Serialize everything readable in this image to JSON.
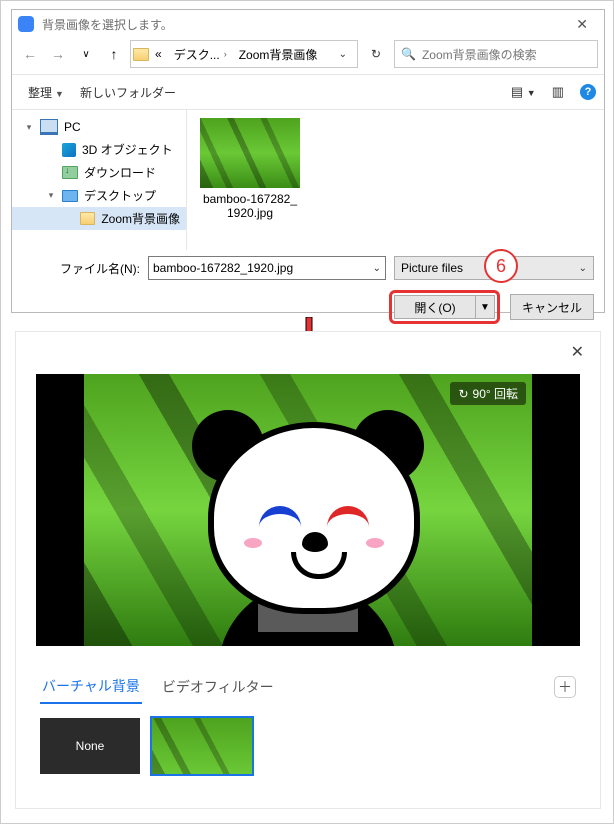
{
  "file_dialog": {
    "title": "背景画像を選択します。",
    "nav": {
      "path_segments": [
        "デスク...",
        "Zoom背景画像"
      ],
      "ellipsis": "«",
      "search_placeholder": "Zoom背景画像の検索"
    },
    "toolbar": {
      "organize": "整理",
      "new_folder": "新しいフォルダー"
    },
    "tree": {
      "pc": "PC",
      "threed": "3D オブジェクト",
      "downloads": "ダウンロード",
      "desktop": "デスクトップ",
      "folder": "Zoom背景画像"
    },
    "file": {
      "name_display": "bamboo-167282_1920.jpg",
      "name_line1": "bamboo-167282_",
      "name_line2": "1920.jpg"
    },
    "footer": {
      "filename_label": "ファイル名(N):",
      "filename_value": "bamboo-167282_1920.jpg",
      "type_label": "Picture files",
      "open_label": "開く(O)",
      "cancel_label": "キャンセル"
    },
    "step_number": "6"
  },
  "settings": {
    "rotate_label": "90° 回転",
    "tab_virtual_bg": "バーチャル背景",
    "tab_video_filter": "ビデオフィルター",
    "none_label": "None"
  }
}
